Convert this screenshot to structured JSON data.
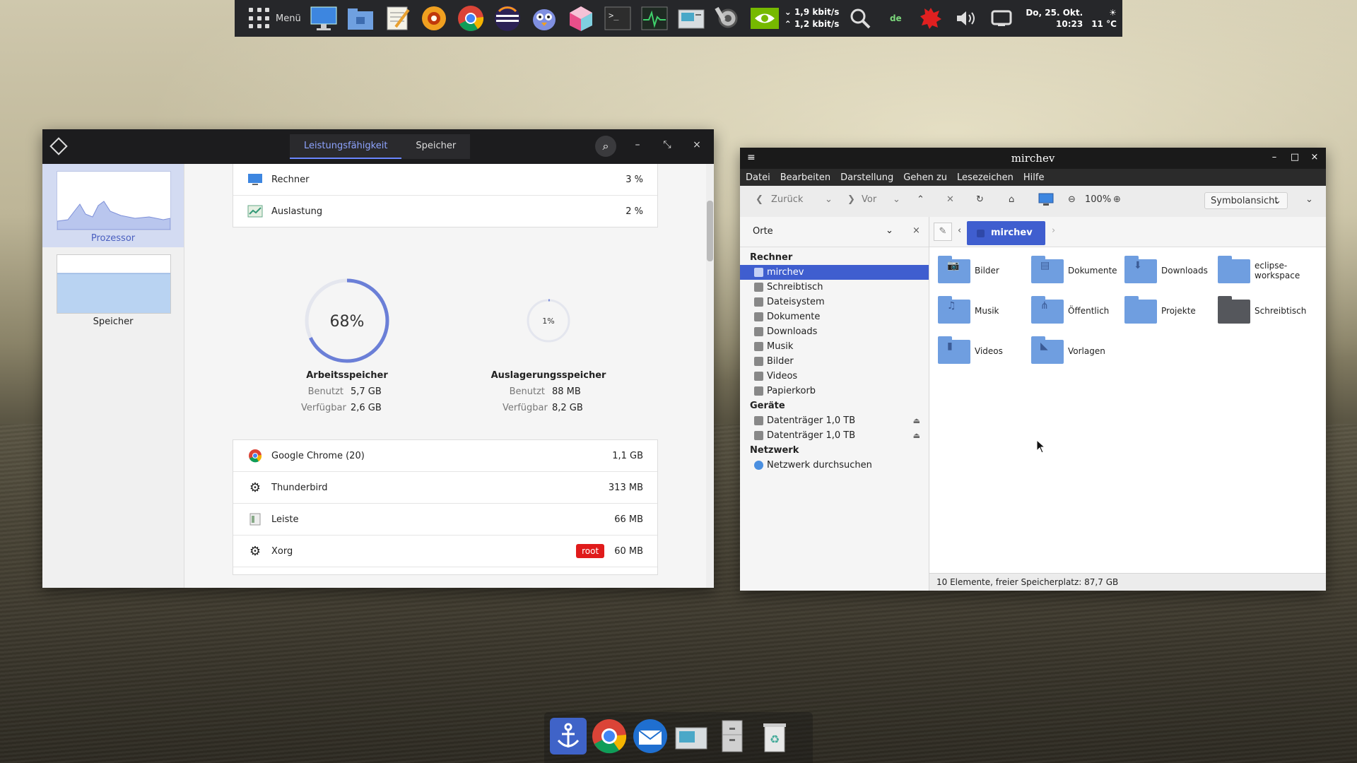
{
  "top_panel": {
    "menu_label": "Menü",
    "launchers": [
      "desktop-icon",
      "home-folder-icon",
      "text-editor-icon",
      "xnview-icon",
      "chrome-icon",
      "eclipse-icon",
      "thunderbird-bird-icon",
      "cube-app-icon",
      "terminal-icon",
      "system-monitor-icon",
      "disk-usage-icon",
      "tools-icon",
      "nvidia-icon"
    ],
    "net_down": "1,9 kbit/s",
    "net_up": "1,2 kbit/s",
    "lang": "de",
    "date": "Do, 25. Okt.",
    "time": "10:23",
    "temperature": "11 °C"
  },
  "system_monitor": {
    "tabs": [
      "Leistungsfähigkeit",
      "Speicher"
    ],
    "active_tab": 0,
    "sidebar": [
      {
        "label": "Prozessor",
        "active": true
      },
      {
        "label": "Speicher",
        "active": false
      }
    ],
    "cpu_rows": [
      {
        "label": "Rechner",
        "value": "3 %",
        "icon": "monitor-icon"
      },
      {
        "label": "Auslastung",
        "value": "2 %",
        "icon": "load-icon"
      }
    ],
    "ram": {
      "percent_label": "68%",
      "fraction": 0.68,
      "title": "Arbeitsspeicher",
      "used_key": "Benutzt",
      "used": "5,7 GB",
      "avail_key": "Verfügbar",
      "avail": "2,6 GB"
    },
    "swap": {
      "percent_label": "1%",
      "fraction": 0.01,
      "title": "Auslagerungsspeicher",
      "used_key": "Benutzt",
      "used": "88 MB",
      "avail_key": "Verfügbar",
      "avail": "8,2 GB"
    },
    "processes": [
      {
        "name": "Google Chrome (20)",
        "mem": "1,1 GB",
        "badge": ""
      },
      {
        "name": "Thunderbird",
        "mem": "313 MB",
        "badge": ""
      },
      {
        "name": "Leiste",
        "mem": "66 MB",
        "badge": ""
      },
      {
        "name": "Xorg",
        "mem": "60 MB",
        "badge": "root"
      }
    ],
    "accent": "#6b7fd7"
  },
  "file_manager": {
    "title": "mirchev",
    "menu": [
      "Datei",
      "Bearbeiten",
      "Darstellung",
      "Gehen zu",
      "Lesezeichen",
      "Hilfe"
    ],
    "toolbar": {
      "back": "Zurück",
      "forward": "Vor",
      "zoom": "100%",
      "view": "Symbolansicht"
    },
    "places_label": "Orte",
    "sections": [
      {
        "title": "Rechner",
        "items": [
          {
            "label": "mirchev",
            "selected": true
          },
          {
            "label": "Schreibtisch"
          },
          {
            "label": "Dateisystem"
          },
          {
            "label": "Dokumente"
          },
          {
            "label": "Downloads"
          },
          {
            "label": "Musik"
          },
          {
            "label": "Bilder"
          },
          {
            "label": "Videos"
          },
          {
            "label": "Papierkorb"
          }
        ]
      },
      {
        "title": "Geräte",
        "items": [
          {
            "label": "Datenträger 1,0 TB",
            "eject": true
          },
          {
            "label": "Datenträger 1,0 TB",
            "eject": true
          }
        ]
      },
      {
        "title": "Netzwerk",
        "items": [
          {
            "label": "Netzwerk durchsuchen"
          }
        ]
      }
    ],
    "breadcrumb": "mirchev",
    "folders": [
      {
        "name": "Bilder",
        "glyph": "📷"
      },
      {
        "name": "Dokumente",
        "glyph": "▤"
      },
      {
        "name": "Downloads",
        "glyph": "⬇"
      },
      {
        "name": "eclipse-workspace",
        "glyph": ""
      },
      {
        "name": "Musik",
        "glyph": "♫"
      },
      {
        "name": "Öffentlich",
        "glyph": "⋔"
      },
      {
        "name": "Projekte",
        "glyph": ""
      },
      {
        "name": "Schreibtisch",
        "glyph": "",
        "dark": true
      },
      {
        "name": "Videos",
        "glyph": "▮"
      },
      {
        "name": "Vorlagen",
        "glyph": "◣"
      }
    ],
    "status": "10 Elemente, freier Speicherplatz: 87,7 GB"
  },
  "dock": [
    "anchor-icon",
    "chrome-icon",
    "mail-icon",
    "disk-usage-icon",
    "file-cabinet-icon",
    "trash-icon"
  ]
}
